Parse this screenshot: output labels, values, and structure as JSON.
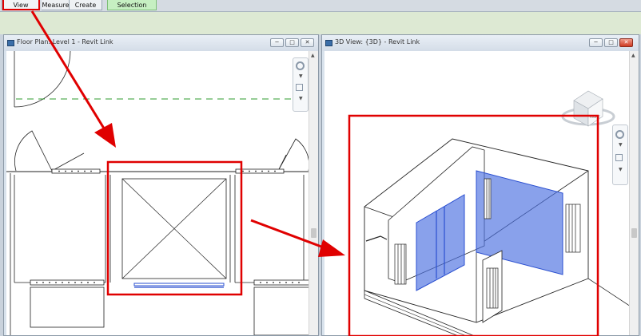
{
  "ribbon": {
    "tabs": [
      {
        "label": "View"
      },
      {
        "label": "Measure"
      },
      {
        "label": "Create"
      },
      {
        "label": "Selection"
      }
    ]
  },
  "left_view": {
    "title": "Floor Plan: Level 1 - Revit Link",
    "buttons": [
      "minimize",
      "maximize",
      "close"
    ]
  },
  "right_view": {
    "title": "3D View: {3D} - Revit Link",
    "buttons": [
      "minimize",
      "maximize",
      "close"
    ],
    "viewcube_face": "RIGHT"
  },
  "colors": {
    "highlight": "#e00000",
    "glazing": "#4a6fe0",
    "selection_tab": "#c6f0c2",
    "gridline": "#2e9b2e"
  },
  "icons": [
    "steering-wheel-icon",
    "zoom-icon",
    "viewcube-icon",
    "arrow-icon"
  ]
}
